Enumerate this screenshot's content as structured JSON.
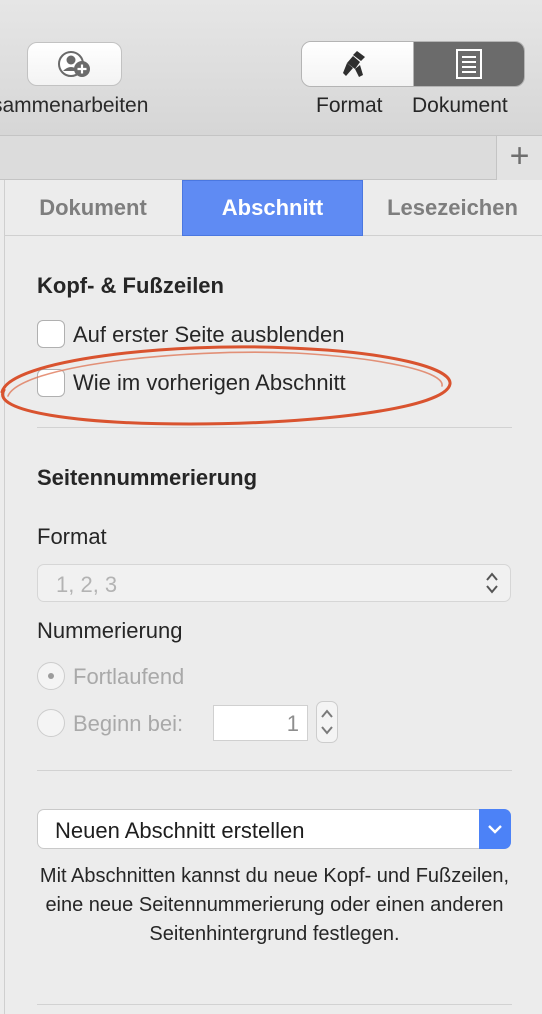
{
  "toolbar": {
    "collaborate_label": "sammenarbeiten",
    "format_label": "Format",
    "document_label": "Dokument"
  },
  "tabbar": {
    "add_symbol": "+"
  },
  "inspector_tabs": [
    {
      "label": "Dokument",
      "selected": false
    },
    {
      "label": "Abschnitt",
      "selected": true
    },
    {
      "label": "Lesezeichen",
      "selected": false
    }
  ],
  "headers_footers": {
    "title": "Kopf- & Fußzeilen",
    "hide_first_page": {
      "label": "Auf erster Seite ausblenden",
      "checked": false
    },
    "match_previous": {
      "label": "Wie im vorherigen Abschnitt",
      "checked": false
    }
  },
  "page_numbering": {
    "title": "Seitennummerierung",
    "format_label": "Format",
    "format_value": "1, 2, 3",
    "numbering_label": "Nummerierung",
    "continue_label": "Fortlaufend",
    "start_at_label": "Beginn bei:",
    "start_at_value": "1"
  },
  "section_popup": {
    "value": "Neuen Abschnitt erstellen"
  },
  "help_text": "Mit Abschnitten kannst du neue Kopf- und Fußzeilen, eine neue Seitennummerierung oder einen anderen Seitenhintergrund festlegen.",
  "colors": {
    "accent": "#5f8bf3",
    "popup_button": "#4c82f7",
    "annotation": "#d9532f"
  },
  "icons": {
    "collaborate": "person-add-icon",
    "format": "paintbrush-icon",
    "document": "document-icon"
  }
}
